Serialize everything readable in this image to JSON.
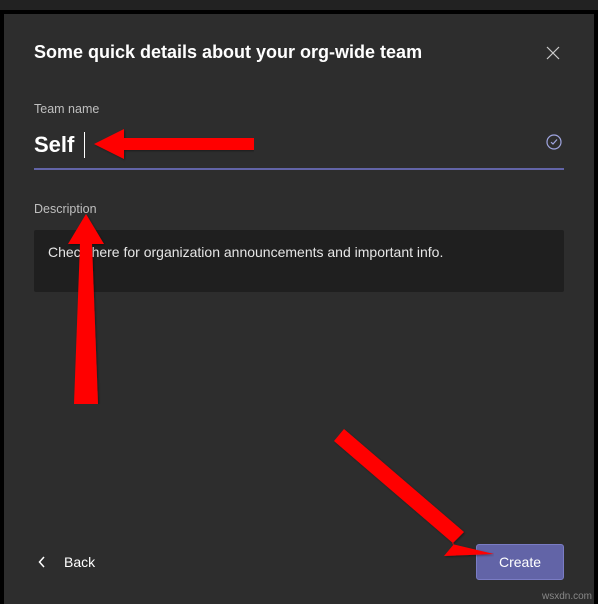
{
  "modal": {
    "title": "Some quick details about your org-wide team",
    "teamNameLabel": "Team name",
    "teamNameValue": "Self",
    "descriptionLabel": "Description",
    "descriptionValue": "Check here for organization announcements and important info.",
    "backLabel": "Back",
    "createLabel": "Create"
  },
  "watermark": "wsxdn.com"
}
